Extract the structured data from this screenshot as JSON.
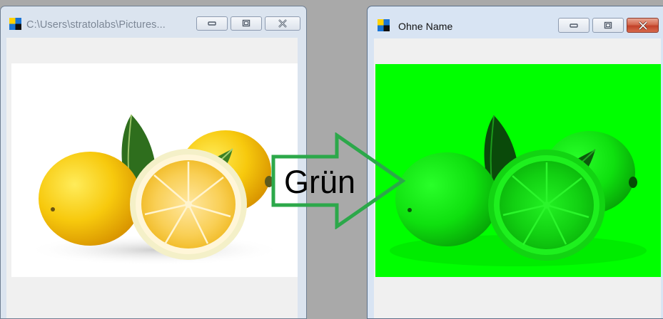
{
  "left_window": {
    "title": "C:\\Users\\stratolabs\\Pictures...",
    "buttons": [
      "minimize",
      "maximize",
      "close"
    ],
    "image": "lemons-original"
  },
  "right_window": {
    "title": "Ohne Name",
    "buttons": [
      "minimize",
      "maximize",
      "close"
    ],
    "image": "lemons-green-filtered"
  },
  "arrow": {
    "label": "Grün",
    "color": "#2ca84a"
  },
  "colors": {
    "desktop": "#a9a9a9",
    "green_fill": "#00ff00",
    "close_active": "#c8462e"
  }
}
